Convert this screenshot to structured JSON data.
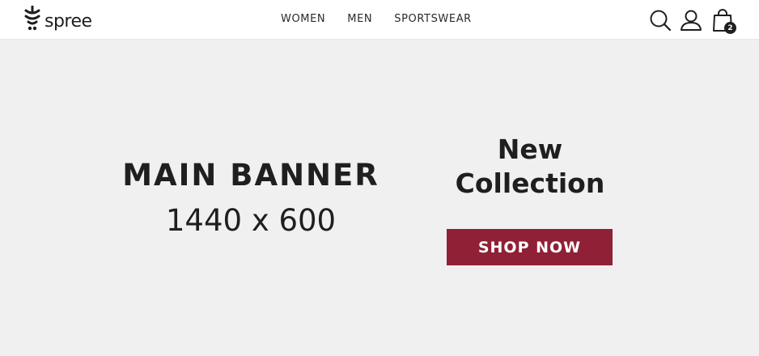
{
  "header": {
    "brand": "spree",
    "nav": [
      {
        "label": "WOMEN"
      },
      {
        "label": "MEN"
      },
      {
        "label": "SPORTSWEAR"
      }
    ],
    "icons": {
      "search": "search-icon",
      "account": "user-icon",
      "cart": "shopping-bag-icon"
    },
    "cart_count": "2"
  },
  "banner": {
    "title": "MAIN BANNER",
    "size": "1440 x 600",
    "heading_line1": "New",
    "heading_line2": "Collection",
    "cta_label": "SHOP NOW"
  },
  "colors": {
    "header_bg": "#ffffff",
    "banner_bg": "#f0f0f0",
    "text": "#1f1f1f",
    "accent": "#8f2036",
    "badge": "#1f1f1f"
  }
}
